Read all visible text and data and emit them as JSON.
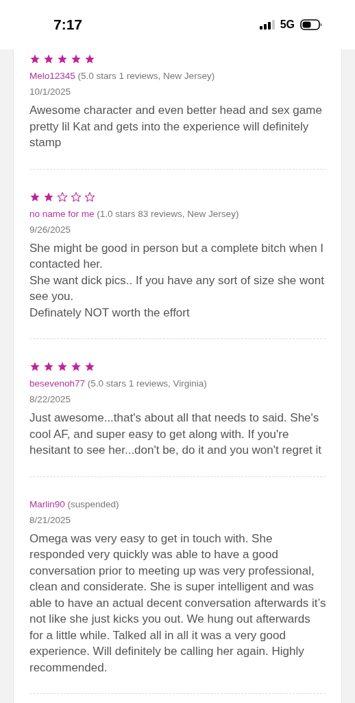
{
  "status_bar": {
    "time": "7:17",
    "network": "5G"
  },
  "reviews": [
    {
      "stars": 5,
      "author": "Melo12345",
      "meta": "(5.0 stars 1 reviews, New Jersey)",
      "date": "10/1/2025",
      "text": "Awesome character and even better head and sex game pretty lil Kat and gets into the experience will definitely stamp"
    },
    {
      "stars": 2,
      "author": "no name for me",
      "meta": "(1.0 stars 83 reviews, New Jersey)",
      "date": "9/26/2025",
      "text": "She might be good in person but a complete bitch when I contacted her.\nShe want dick pics.. If you have any sort of size she wont see you.\nDefinately NOT worth the effort"
    },
    {
      "stars": 5,
      "author": "besevenoh77",
      "meta": "(5.0 stars 1 reviews, Virginia)",
      "date": "8/22/2025",
      "text": "Just awesome...that's about all that needs to said. She's cool AF, and super easy to get along with. If you're hesitant to see her...don't be, do it and you won't regret it"
    },
    {
      "author": "Marlin90",
      "meta": "(suspended)",
      "date": "8/21/2025",
      "text": "Omega was very easy to get in touch with. She responded very quickly was able to have a good conversation prior to meeting up was very professional, clean and considerate. She is super intelligent and was able to have an actual decent conversation afterwards it’s not like she just kicks you out. We hung out afterwards for a little while. Talked all in all it was a very good experience. Will definitely be calling her again. Highly recommended."
    }
  ]
}
